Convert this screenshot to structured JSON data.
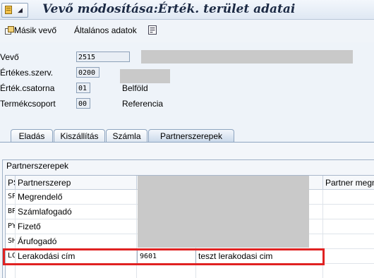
{
  "window": {
    "title": "Vevő módosítása:Érték. terület adatai"
  },
  "toolbar": {
    "other_customer": "Másik vevő",
    "general_data": "Általános adatok"
  },
  "header_fields": [
    {
      "label": "Vevő",
      "value": "2515"
    },
    {
      "label": "Értékes.szerv.",
      "value": "0200"
    },
    {
      "label": "Érték.csatorna",
      "value": "01",
      "desc": "Belföld"
    },
    {
      "label": "Termékcsoport",
      "value": "00",
      "desc": "Referencia"
    }
  ],
  "tabs": [
    {
      "label": "Eladás"
    },
    {
      "label": "Kiszállítás"
    },
    {
      "label": "Számla"
    },
    {
      "label": "Partnerszerepek"
    }
  ],
  "partner_group": {
    "title": "Partnerszerepek",
    "columns": [
      "PSz",
      "Partnerszerep",
      "Partner megn"
    ],
    "rows": [
      {
        "code": "SP",
        "role": "Megrendelő",
        "number": "",
        "desc": ""
      },
      {
        "code": "BP",
        "role": "Számlafogadó",
        "number": "",
        "desc": ""
      },
      {
        "code": "PY",
        "role": "Fizető",
        "number": "",
        "desc": ""
      },
      {
        "code": "SH",
        "role": "Árufogadó",
        "number": "",
        "desc": ""
      },
      {
        "code": "LC",
        "role": "Lerakodási cím",
        "number": "9601",
        "desc": "teszt lerakodasi cim"
      }
    ]
  },
  "colors": {
    "highlight": "#e02222",
    "redacted": "#c9c9c9"
  }
}
